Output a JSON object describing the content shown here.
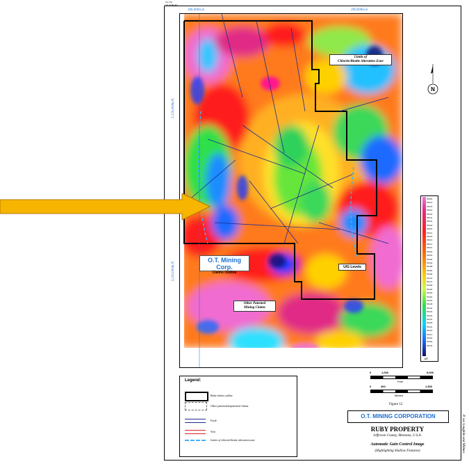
{
  "header_scribble": [
    "PR-TSR",
    "UR  UR   ■  ▪  ■ ▪"
  ],
  "top_coords": [
    "396,000m.E.",
    "390,000m.E."
  ],
  "left_coords": [
    "5,120,000m.N.",
    "5,110,000m.N."
  ],
  "callouts": {
    "chlorite": [
      "Limits of",
      "Chlorite/Biotite Alteration Zone"
    ],
    "ot_name": "O.T. Mining Corp.",
    "ot_sub": "Claims Outline",
    "other": [
      "Other Patented",
      "Mining Claims"
    ],
    "ug": "U/G Levels"
  },
  "colorbar": {
    "labels": [
      "55683",
      "55612",
      "55578",
      "55561",
      "55549",
      "55541",
      "55534",
      "55529",
      "55525",
      "55521",
      "55518",
      "55515",
      "55511",
      "55507",
      "55504",
      "55500",
      "55496",
      "55492",
      "55488",
      "55484",
      "55480",
      "55476",
      "55472",
      "55468",
      "55464",
      "55460",
      "55456",
      "55452",
      "55448",
      "55444",
      "55440",
      "55436",
      "55432",
      "55428",
      "55424",
      "55420",
      "55410",
      "55399",
      "55384",
      "55346"
    ],
    "unit": "nT"
  },
  "legend": {
    "title": "Legend:",
    "items": [
      {
        "label": "Ruby claims outline"
      },
      {
        "label": "Other patented/unpatented claims"
      },
      {
        "label": "Fault"
      },
      {
        "label": "Vein"
      },
      {
        "label": "Limits of chlorite/biotite alteration zone"
      }
    ]
  },
  "scale": {
    "feet_ticks": [
      "0",
      "1,000",
      "5,000"
    ],
    "feet_label": "Feet",
    "metres_ticks": [
      "0",
      "300",
      "1,500"
    ],
    "metres_label": "Metres"
  },
  "figure_label": "Figure 12",
  "company": "O.T. MINING CORPORATION",
  "property": "RUBY PROPERTY",
  "location": "Jefferson County, Montana, U.S.A.",
  "image_title": "Automatic Gain Control Image",
  "image_subtitle": "(Highlighting Shallow Features)",
  "side_text": "P. see Loughlin and Milmes",
  "colors": {
    "accent_blue": "#1f6fd0",
    "arrow_fill": "#f7b500",
    "arrow_stroke": "#b07a00"
  }
}
